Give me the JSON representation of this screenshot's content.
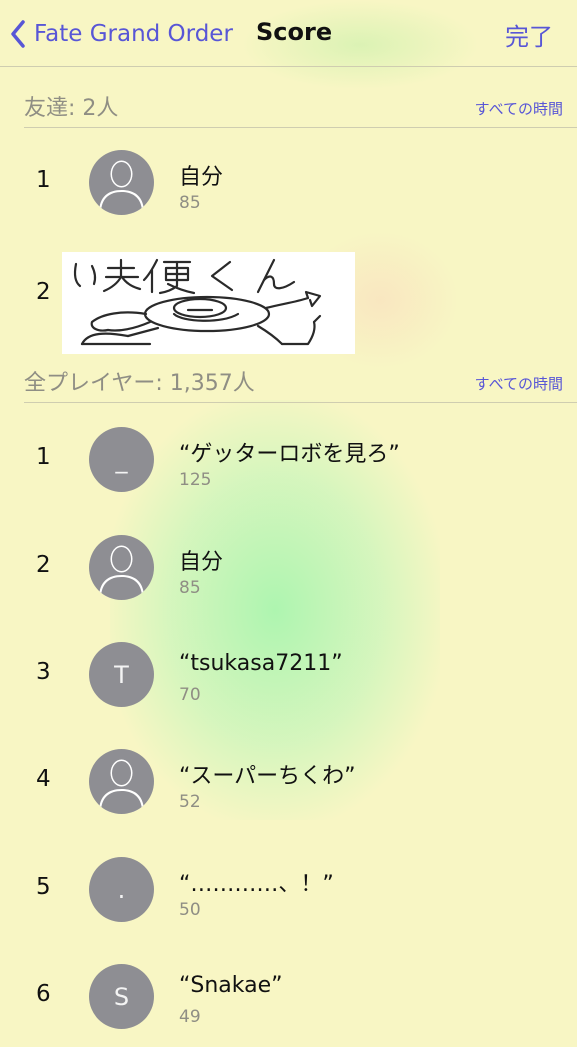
{
  "nav": {
    "back_label": "Fate Grand Order",
    "title": "Score",
    "done_label": "完了"
  },
  "friends_section": {
    "title": "友達: 2人",
    "link": "すべての時間",
    "rows": [
      {
        "rank": "1",
        "name": "自分",
        "score": "85",
        "avatar": "person-silhouette"
      },
      {
        "rank": "2",
        "image": "handwritten-sketch",
        "sketch_text": "い夫便くん"
      }
    ]
  },
  "all_section": {
    "title": "全プレイヤー: 1,357人",
    "link": "すべての時間",
    "rows": [
      {
        "rank": "1",
        "name": "“ゲッターロボを見ろ”",
        "score": "125",
        "avatar_initial": "_"
      },
      {
        "rank": "2",
        "name": "自分",
        "score": "85",
        "avatar": "person-silhouette"
      },
      {
        "rank": "3",
        "name": "“tsukasa7211”",
        "score": "70",
        "avatar_initial": "T"
      },
      {
        "rank": "4",
        "name": "“スーパーちくわ”",
        "score": "52",
        "avatar": "person-silhouette"
      },
      {
        "rank": "5",
        "name": "“…………、！”",
        "score": "50",
        "avatar_initial": "."
      },
      {
        "rank": "6",
        "name": "“Snakae”",
        "score": "49",
        "avatar_initial": "S"
      }
    ]
  },
  "colors": {
    "accent": "#5856d6",
    "background": "#f8f6c4",
    "avatar": "#8e8e93",
    "secondary_text": "#8f8e84"
  }
}
